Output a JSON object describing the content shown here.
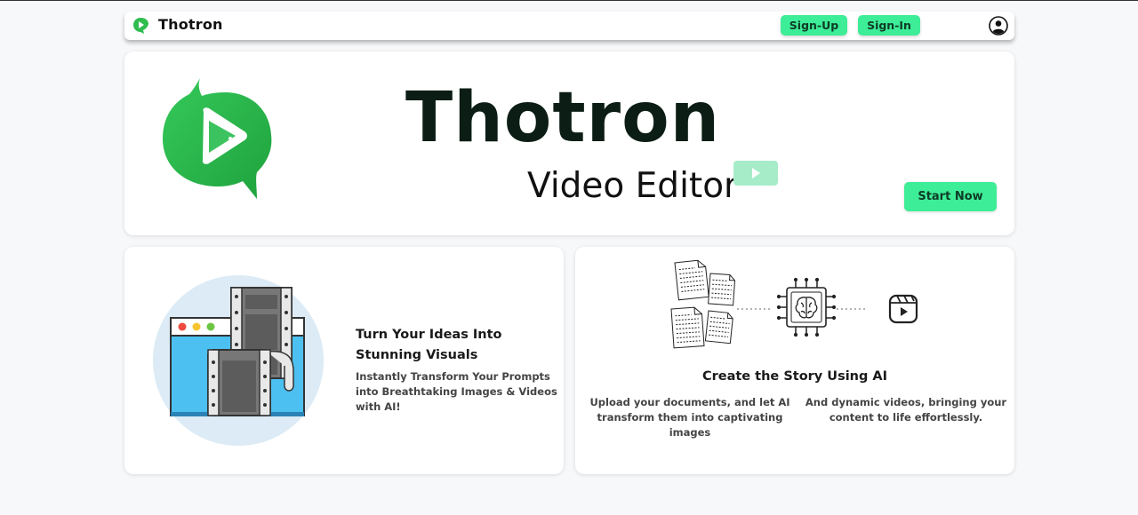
{
  "navbar": {
    "brand_name": "Thotron",
    "signup_label": "Sign-Up",
    "signin_label": "Sign-In"
  },
  "hero": {
    "title": "Thotron",
    "subtitle": "Video Editor",
    "cta_label": "Start Now"
  },
  "features": [
    {
      "title": "Turn Your Ideas Into Stunning Visuals",
      "description": "Instantly Transform Your Prompts into Breathtaking Images & Videos with AI!"
    },
    {
      "title": "Create the Story Using AI",
      "left_text": "Upload your documents, and let AI transform them into captivating images",
      "right_text": "And dynamic videos, bringing your content to life effortlessly."
    }
  ],
  "colors": {
    "accent": "#3ded97",
    "logo_green": "#2fbd4f",
    "background": "#f7f8fa"
  },
  "icons": [
    "thotron-logo-icon",
    "user-circle-icon",
    "play-icon",
    "documents-icon",
    "ai-chip-icon",
    "video-reel-icon"
  ]
}
